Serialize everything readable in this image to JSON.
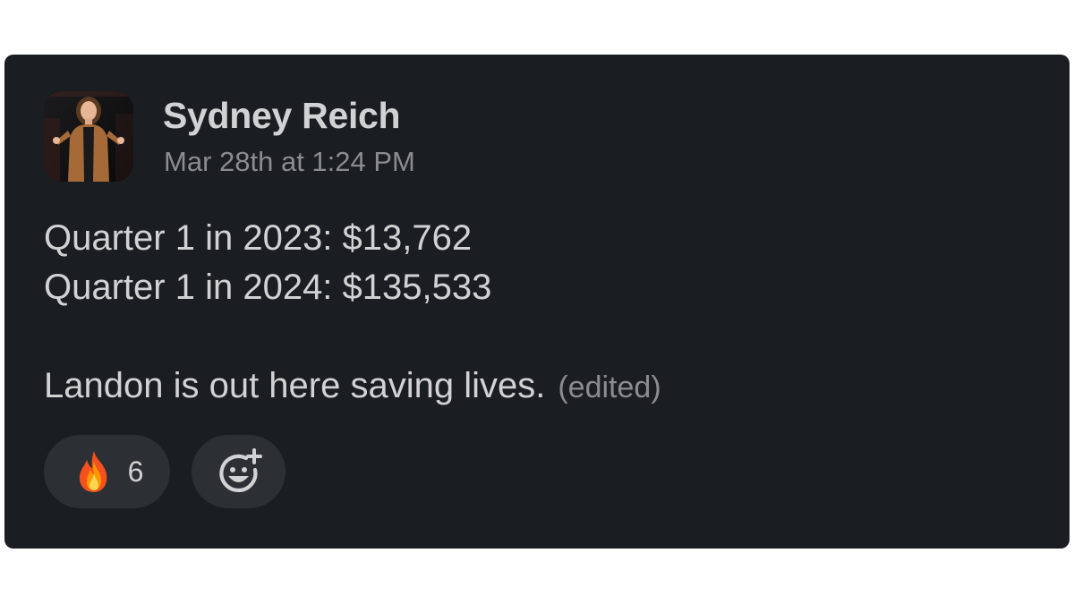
{
  "message": {
    "author": "Sydney Reich",
    "timestamp": "Mar 28th at 1:24 PM",
    "lines": [
      "Quarter 1 in 2023: $13,762",
      "Quarter 1 in 2024: $135,533",
      "",
      "Landon is out here saving lives."
    ],
    "edited_label": "(edited)"
  },
  "reactions": [
    {
      "icon": "fire-emoji-icon",
      "count": "6"
    },
    {
      "icon": "add-reaction-icon"
    }
  ],
  "colors": {
    "card_background": "#1a1d21",
    "text": "#d1d2d3",
    "muted_text": "#8a8c8f",
    "reaction_background": "#2c2f33"
  }
}
